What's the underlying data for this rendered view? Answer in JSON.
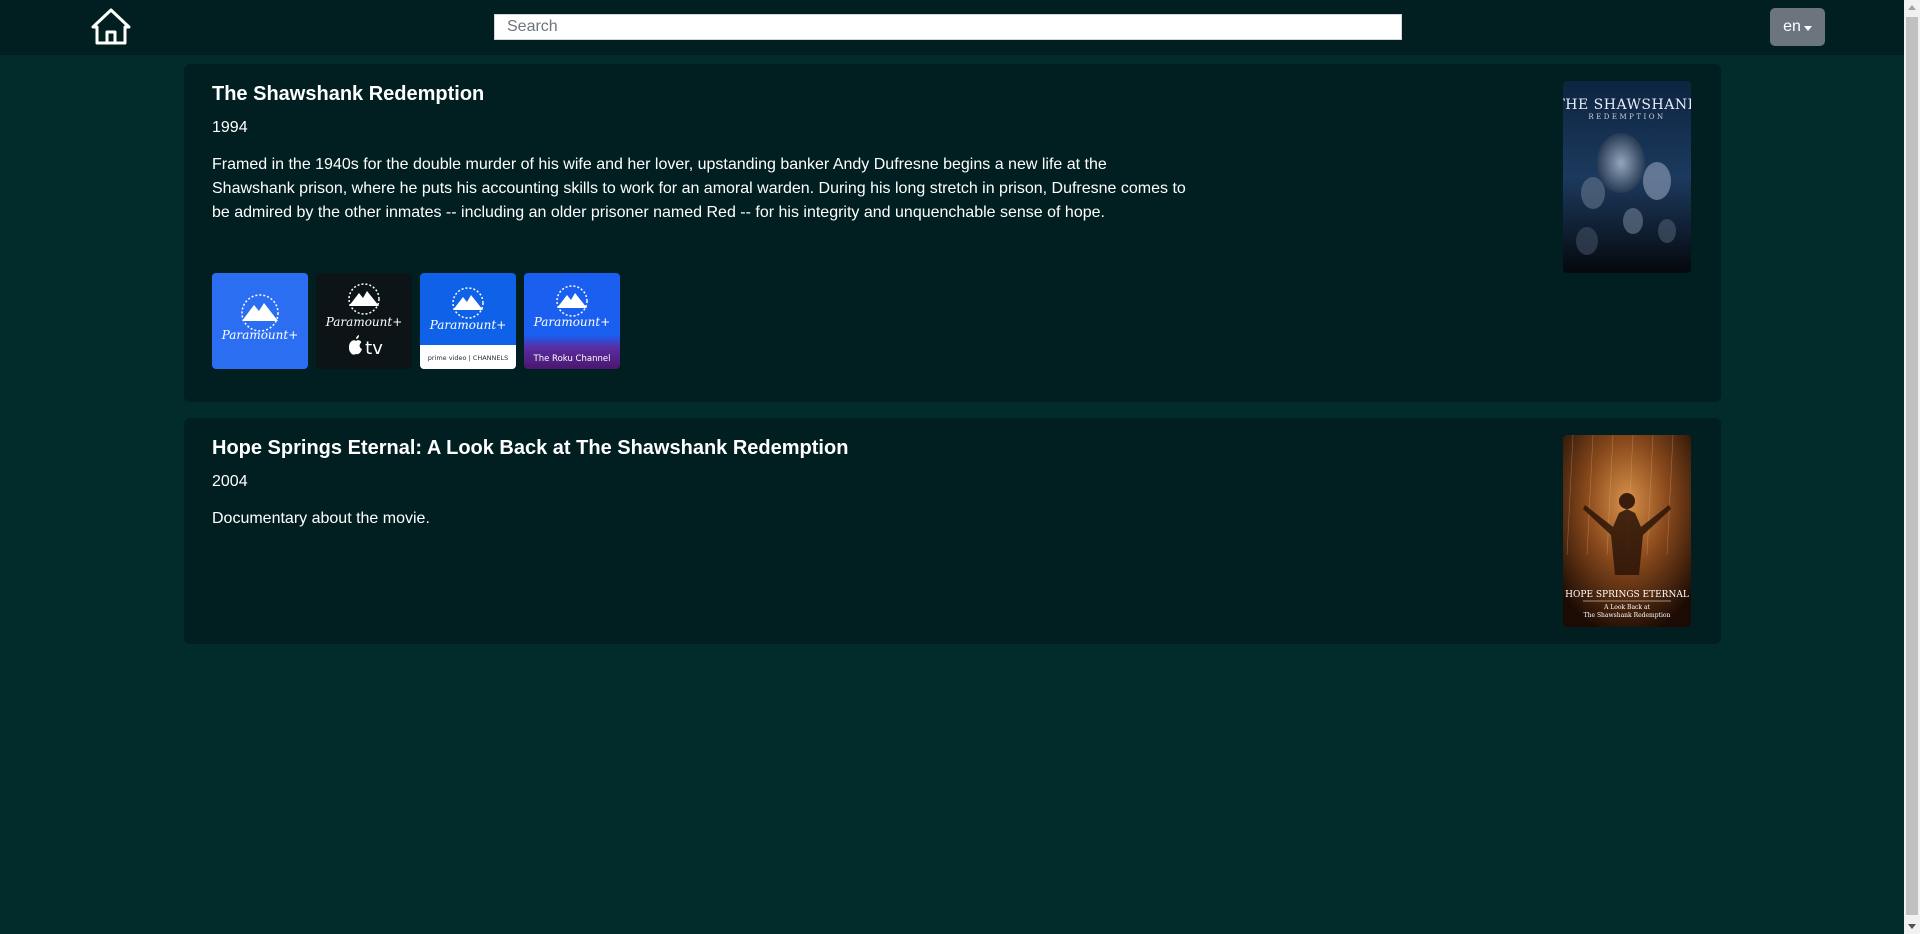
{
  "header": {
    "home_icon": "home-icon",
    "search": {
      "placeholder": "Search",
      "value": ""
    },
    "language": {
      "label": "en",
      "icon": "chevron-down-icon"
    }
  },
  "movies": [
    {
      "title": "The Shawshank Redemption",
      "year": "1994",
      "overview": "Framed in the 1940s for the double murder of his wife and her lover, upstanding banker Andy Dufresne begins a new life at the Shawshank prison, where he puts his accounting skills to work for an amoral warden. During his long stretch in prison, Dufresne comes to be admired by the other inmates -- including an older prisoner named Red -- for his integrity and unquenchable sense of hope.",
      "poster": {
        "title": "THE SHAWSHANK",
        "subtitle": "REDEMPTION",
        "icon": "movie-poster-image"
      },
      "providers": [
        {
          "logo": "Paramount+",
          "extra": "",
          "theme": "paramount-blue"
        },
        {
          "logo": "Paramount+",
          "extra": "tv",
          "theme": "apple-tv-dark"
        },
        {
          "logo": "Paramount+",
          "extra": "prime video | CHANNELS",
          "theme": "amazon-channel"
        },
        {
          "logo": "Paramount+",
          "extra": "The Roku Channel",
          "theme": "roku-channel"
        }
      ]
    },
    {
      "title": "Hope Springs Eternal: A Look Back at The Shawshank Redemption",
      "year": "2004",
      "overview": "Documentary about the movie.",
      "poster": {
        "title": "HOPE SPRINGS ETERNAL",
        "line2": "A Look Back at",
        "line3": "The Shawshank Redemption",
        "icon": "movie-poster-image"
      },
      "providers": []
    }
  ],
  "colors": {
    "page_background": "#022b2c",
    "navbar_background": "#011f20",
    "card_background": "#011f20",
    "paramount_blue": "#2c6ef2",
    "language_button": "#6c757d"
  }
}
